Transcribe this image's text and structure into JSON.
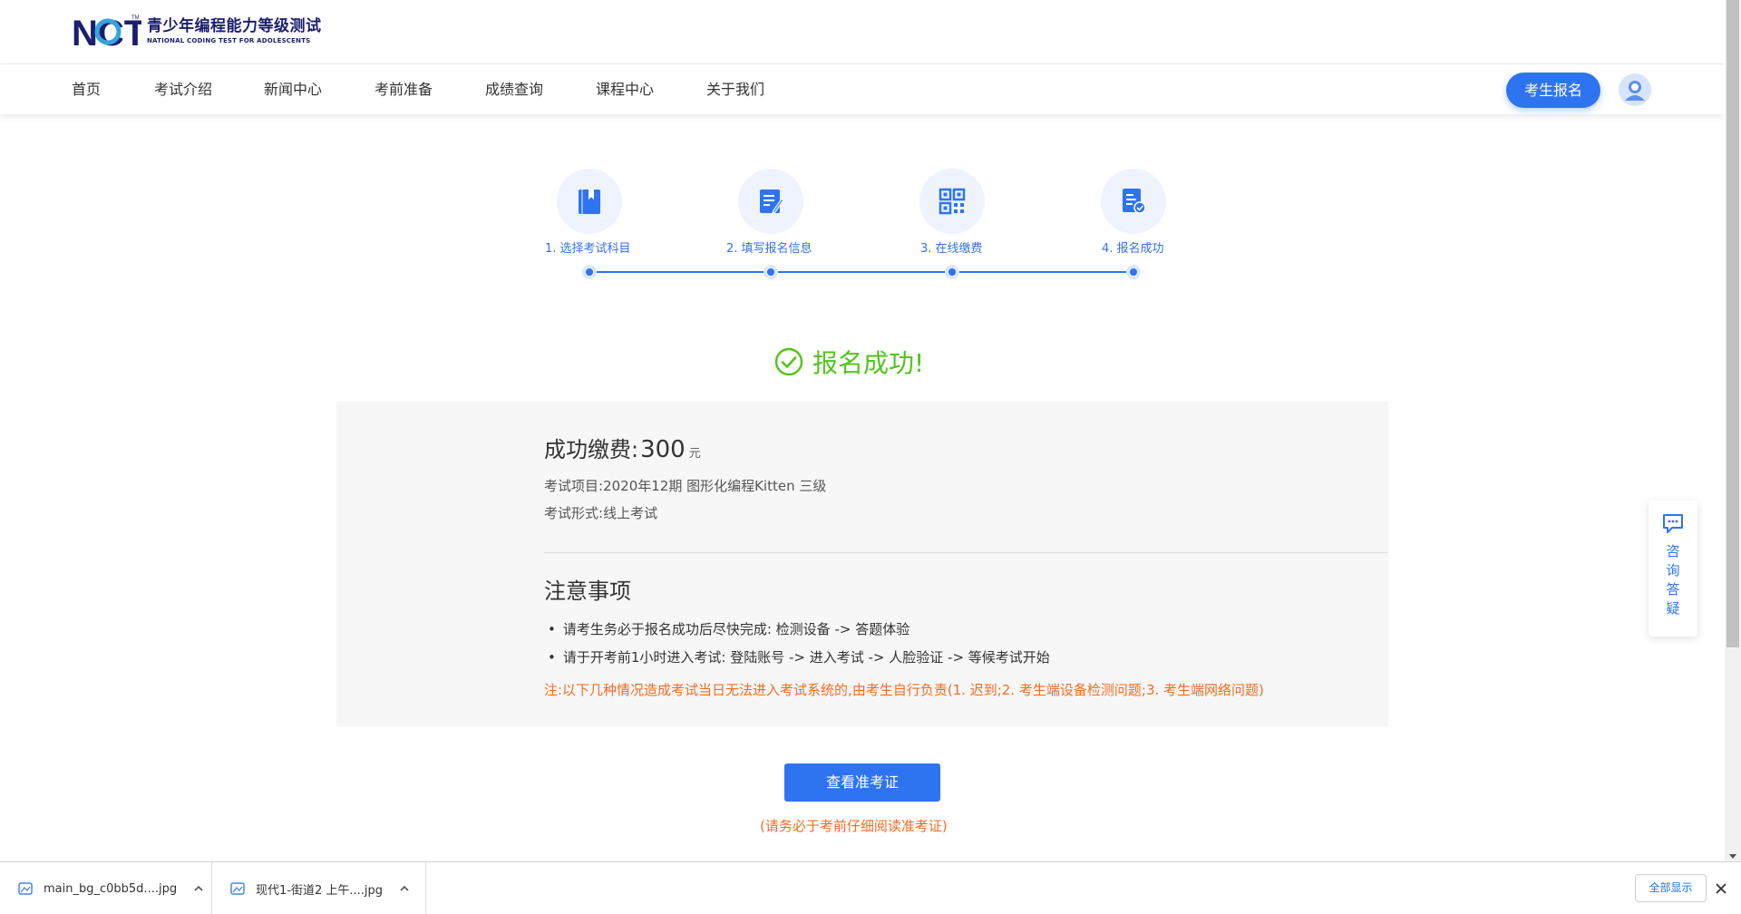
{
  "logo": {
    "mark_text": "NCT",
    "trademark": "TM",
    "title_cn": "青少年编程能力等级测试",
    "title_en": "NATIONAL CODING TEST FOR ADOLESCENTS"
  },
  "nav": {
    "items": [
      {
        "label": "首页"
      },
      {
        "label": "考试介绍"
      },
      {
        "label": "新闻中心"
      },
      {
        "label": "考前准备"
      },
      {
        "label": "成绩查询"
      },
      {
        "label": "课程中心"
      },
      {
        "label": "关于我们"
      }
    ],
    "signup_label": "考生报名"
  },
  "steps": [
    {
      "label": "1. 选择考试科目",
      "icon": "book-icon"
    },
    {
      "label": "2. 填写报名信息",
      "icon": "edit-form-icon"
    },
    {
      "label": "3. 在线缴费",
      "icon": "qr-code-icon"
    },
    {
      "label": "4. 报名成功",
      "icon": "document-check-icon"
    }
  ],
  "success": {
    "title": "报名成功!"
  },
  "payment": {
    "label": "成功缴费:",
    "amount": "300",
    "unit": "元",
    "project_label": "考试项目:",
    "project_value": "2020年12期 图形化编程Kitten 三级",
    "format_label": "考试形式:",
    "format_value": "线上考试"
  },
  "notice": {
    "title": "注意事项",
    "items": [
      "请考生务必于报名成功后尽快完成:  检测设备 -> 答题体验",
      "请于开考前1小时进入考试:  登陆账号 -> 进入考试 -> 人脸验证 -> 等候考试开始"
    ],
    "warning": "注:以下几种情况造成考试当日无法进入考试系统的,由考生自行负责(1. 迟到;2. 考生端设备检测问题;3. 考生端网络问题)"
  },
  "admission": {
    "button_label": "查看准考证",
    "note": "(请务必于考前仔细阅读准考证)"
  },
  "consult": {
    "label": "咨询答疑"
  },
  "downloads": {
    "items": [
      {
        "name": "main_bg_c0bb5d....jpg"
      },
      {
        "name": "现代1-街道2 上午....jpg"
      }
    ],
    "show_all_label": "全部显示"
  },
  "colors": {
    "primary": "#2e74f0",
    "success": "#52c41a",
    "warning": "#f56c23",
    "logo_navy": "#1b1f6e"
  }
}
